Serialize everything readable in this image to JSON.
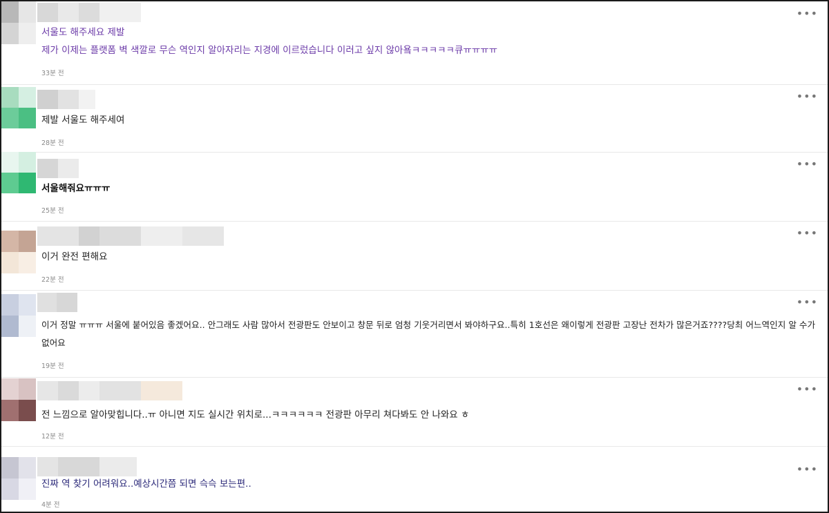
{
  "comments": [
    {
      "text": "서울도 해주세요 제발\n제가 이제는 플랫폼 벽 색깔로 무슨 역인지 알아자리는 지경에 이르렀습니다 이러고 싶지 않아욬ㅋㅋㅋㅋㅋ큐ㅠㅠㅠㅠ",
      "time": "33분 전",
      "avatar_colors": [
        "#b8b8b8",
        "#e6e6e6",
        "#d4d4d4",
        "#eeeeee"
      ],
      "nick_colors": [
        "#d8d8d8",
        "#e9e9e9",
        "#dcdcdc",
        "#f0f0f0"
      ],
      "more": "•••"
    },
    {
      "text": "제발 서울도 해주세여",
      "time": "28분 전",
      "avatar_colors": [
        "#a8dcbf",
        "#d5efe2",
        "#6ccc9a",
        "#4bbf83"
      ],
      "nick_colors": [
        "#d0d0d0",
        "#e2e2e2",
        "#f2f2f2"
      ],
      "more": "•••"
    },
    {
      "text": "서울해줘요ㅠㅠㅠ",
      "time": "25분 전",
      "avatar_colors": [
        "#e8f6ef",
        "#d4efe1",
        "#5ecb91",
        "#2fb872"
      ],
      "nick_colors": [
        "#d6d6d6",
        "#ebebeb"
      ],
      "more": "•••"
    },
    {
      "text": "이거 완전 편해요",
      "time": "22분 전",
      "avatar_colors": [
        "#d4b6a6",
        "#c4a494",
        "#f3e6d8",
        "#f8eee4"
      ],
      "nick_colors": [
        "#e4e4e4",
        "#d2d2d2",
        "#dcdcdc",
        "#eeeeee",
        "#e6e6e6"
      ],
      "more": "•••"
    },
    {
      "text": "이거 정말 ㅠㅠㅠ 서울에 붙어있음 좋겠어요.. 안그래도 사람 많아서 전광판도 안보이고 창문 뒤로 엄청 기웃거리면서 봐야하구요..특히 1호선은 왜이렇게 전광판 고장난 전차가 많은거죠????당최 어느역인지 알 수가 없어요",
      "time": "19분 전",
      "avatar_colors": [
        "#c8cfe0",
        "#dfe4ef",
        "#b0bad0",
        "#eef1f6"
      ],
      "nick_colors": [
        "#e0e0e0",
        "#d7d7d7"
      ],
      "more": "•••"
    },
    {
      "text": "전 느낌으로 알아맞힙니다..ㅠ 아니면 지도 실시간 위치로...ㅋㅋㅋㅋㅋㅋ 전광판 아무리 쳐다봐도 안 나와요 ㅎ",
      "time": "12분 전",
      "avatar_colors": [
        "#e4d2d2",
        "#d8c2c2",
        "#a07070",
        "#7a4d4d"
      ],
      "nick_colors": [
        "#e6e6e6",
        "#dadada",
        "#ececec",
        "#e2e2e2",
        "#f5e9dc",
        "#ededed"
      ],
      "more": "•••"
    },
    {
      "text": "진짜 역 찾기 어려워요..예상시간쯤 되면 슥슥 보는편..",
      "time": "4분 전",
      "avatar_colors": [
        "#c6c6d2",
        "#e2e2ea",
        "#d8d8e4",
        "#f0f0f6"
      ],
      "nick_colors": [
        "#e4e4e4",
        "#d8d8d8",
        "#ebebeb"
      ],
      "more": "•••"
    }
  ]
}
